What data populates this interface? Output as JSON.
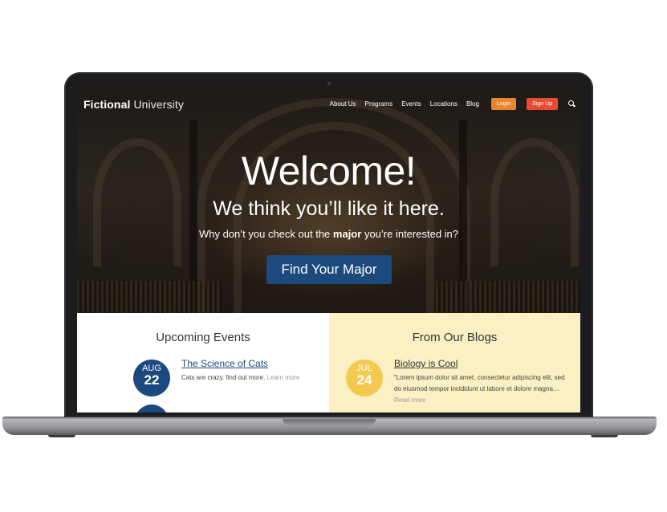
{
  "site": {
    "logo_bold": "Fictional",
    "logo_light": "University"
  },
  "nav": {
    "links": [
      "About Us",
      "Programs",
      "Events",
      "Locations",
      "Blog"
    ],
    "login": "Login",
    "signup": "Sign Up",
    "search_icon": "search-icon"
  },
  "hero": {
    "heading": "Welcome!",
    "subheading": "We think you’ll like it here.",
    "line_before": "Why don’t you check out the",
    "line_bold": "major",
    "line_after": "you’re interested in?",
    "cta": "Find Your Major"
  },
  "events": {
    "title": "Upcoming Events",
    "item": {
      "month": "AUG",
      "day": "22",
      "title": "The Science of Cats",
      "text": "Cats are crazy. find out more.",
      "more": "Learn more"
    }
  },
  "blogs": {
    "title": "From Our Blogs",
    "item": {
      "month": "JUL",
      "day": "24",
      "title": "Biology is Cool",
      "text": "“Lorem ipsum dolor sit amet, consectetur adipiscing elit, sed do eiusmod tempor incididunt ut labore et dolore magna…",
      "more": "Read more"
    }
  },
  "colors": {
    "primary_blue": "#1d4a7e",
    "login_orange": "#e8862e",
    "signup_red": "#e84a36",
    "blog_bg": "#fbf0c3",
    "date_yellow": "#f3c94f"
  }
}
